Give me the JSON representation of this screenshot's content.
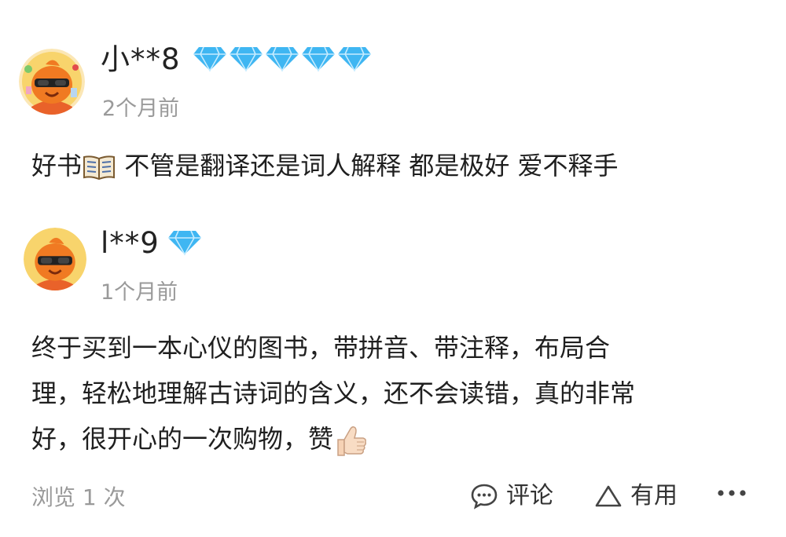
{
  "reviews": [
    {
      "username": "小**8",
      "level_icon": "diamond-icon",
      "level_count": 5,
      "time": "2个月前",
      "text_before_emoji": "好书",
      "emoji": "open-book-icon",
      "text_after_emoji": " 不管是翻译还是词人解释 都是极好 爱不释手"
    },
    {
      "username": "l**9",
      "level_icon": "diamond-icon",
      "level_count": 1,
      "time": "1个月前",
      "lines": [
        "终于买到一本心仪的图书，带拼音、带注释，布局合",
        "理，轻松地理解古诗词的含义，还不会读错，真的非常",
        "好，很开心的一次购物，赞"
      ],
      "emoji": "thumbs-up-icon"
    }
  ],
  "footer": {
    "views": "浏览 1 次",
    "comment_label": "评论",
    "useful_label": "有用",
    "more_icon": "more-icon"
  },
  "colors": {
    "diamond": "#3fb6f2",
    "muted_text": "#9a9a9a",
    "avatar_bg": "#f6c64a",
    "mascot": "#f07a22"
  }
}
